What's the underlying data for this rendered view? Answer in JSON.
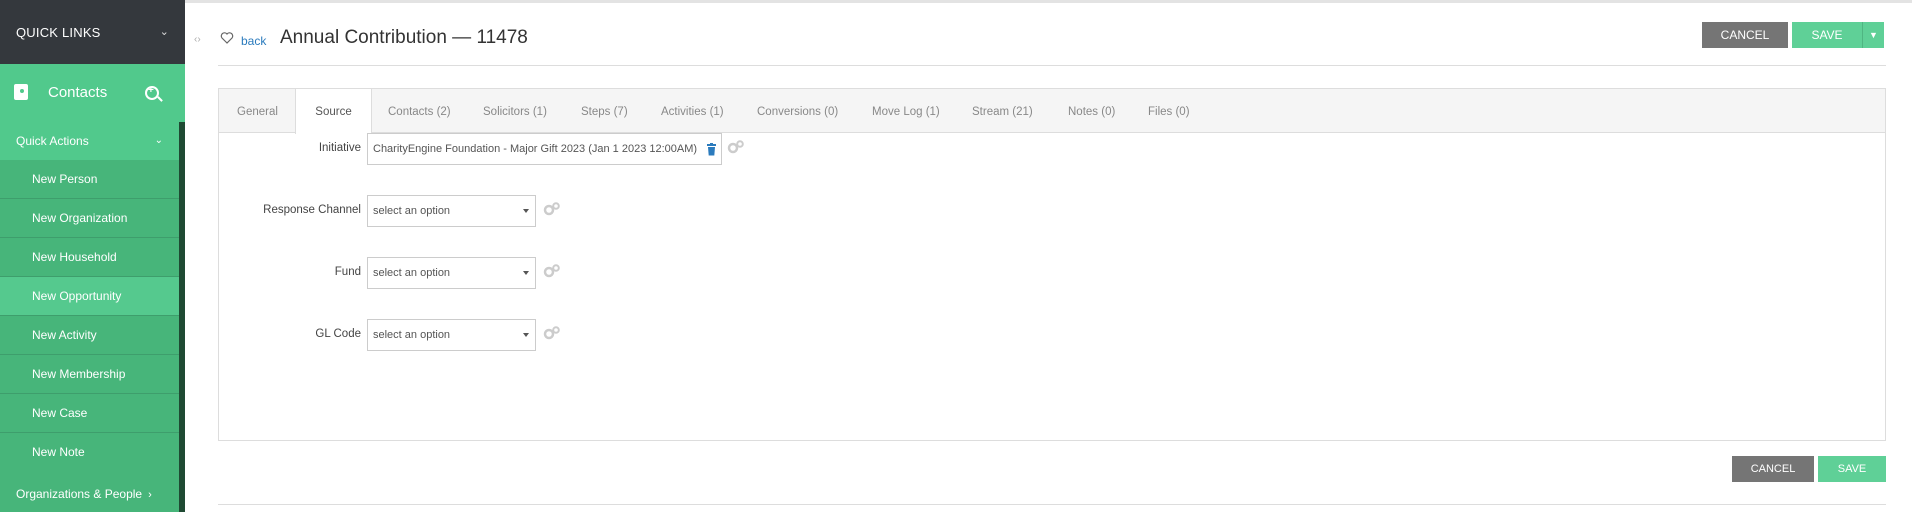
{
  "sidebar": {
    "quick_links": "QUICK LINKS",
    "section_title": "Contacts",
    "quick_actions": "Quick Actions",
    "items": [
      {
        "label": "New Person"
      },
      {
        "label": "New Organization"
      },
      {
        "label": "New Household"
      },
      {
        "label": "New Opportunity"
      },
      {
        "label": "New Activity"
      },
      {
        "label": "New Membership"
      },
      {
        "label": "New Case"
      },
      {
        "label": "New Note"
      }
    ],
    "active_item": "New Opportunity",
    "orgs_people": "Organizations & People",
    "icons": [
      "chevron-down-icon",
      "contacts-book-icon",
      "search-plus-icon",
      "chevron-right-icon"
    ]
  },
  "header": {
    "back_label": "back",
    "title": "Annual Contribution — 11478",
    "cancel_label": "CANCEL",
    "save_label": "SAVE"
  },
  "tabs": [
    {
      "label": "General"
    },
    {
      "label": "Source"
    },
    {
      "label": "Contacts (2)"
    },
    {
      "label": "Solicitors (1)"
    },
    {
      "label": "Steps (7)"
    },
    {
      "label": "Activities (1)"
    },
    {
      "label": "Conversions (0)"
    },
    {
      "label": "Move Log (1)"
    },
    {
      "label": "Stream (21)"
    },
    {
      "label": "Notes (0)"
    },
    {
      "label": "Files (0)"
    }
  ],
  "active_tab": "Source",
  "form": {
    "initiative": {
      "label": "Initiative",
      "value": "CharityEngine Foundation - Major Gift 2023 (Jan 1 2023 12:00AM)"
    },
    "response_channel": {
      "label": "Response Channel",
      "value": "select an option"
    },
    "fund": {
      "label": "Fund",
      "value": "select an option"
    },
    "gl_code": {
      "label": "GL Code",
      "value": "select an option"
    }
  },
  "footer": {
    "cancel_label": "CANCEL",
    "save_label": "SAVE"
  },
  "colors": {
    "sidebar_green": "#47b57a",
    "active_green": "#51c98c",
    "dark_header": "#34383d",
    "save_green": "#5fd097",
    "cancel_gray": "#757575",
    "link_blue": "#2b7bbd",
    "trash_blue": "#2b7bbd"
  }
}
